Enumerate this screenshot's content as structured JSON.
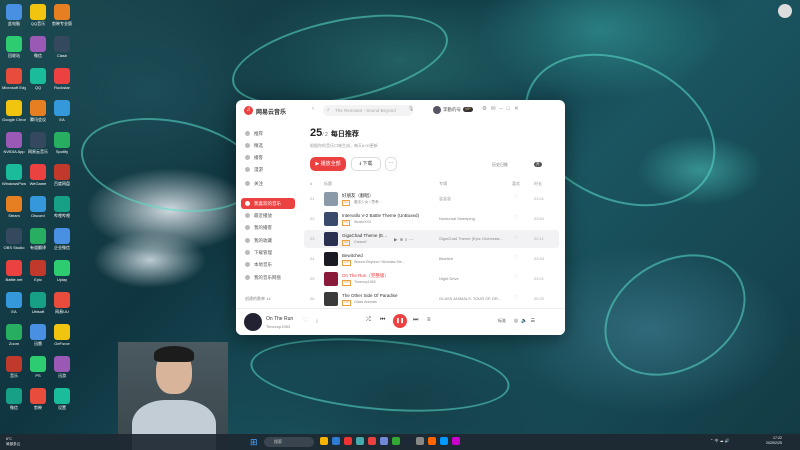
{
  "desktop": {
    "icons_left": [
      "此电脑",
      "回收站",
      "Microsoft Edge",
      "Google Chrome",
      "NVIDIA App",
      "WindowsPowerShell",
      "Steam",
      "OBS Studio",
      "Battle.net",
      "EA",
      "Zoom",
      "音乐",
      "微信"
    ],
    "icons_second": [
      "QQ音乐",
      "微信",
      "QQ",
      "腾讯会议",
      "网易云音乐",
      "WeGame",
      "Discord",
      "有道翻译",
      "Epic",
      "Ubisoft",
      "迅雷",
      "PS",
      "剪映"
    ],
    "icons_third": [
      "剪映专业版",
      "Clash",
      "Rockstar",
      "EA",
      "Spotify",
      "百度网盘",
      "哔哩哔哩",
      "企业微信",
      "Uplay",
      "网易UU",
      "GeForce",
      "迅游",
      "设置"
    ]
  },
  "window": {
    "app_name": "网易云音乐",
    "search_placeholder": "The Remnant - Sound Beyond",
    "username": "李勤的号",
    "vip_badge": "VIP",
    "sidebar": [
      {
        "label": "推荐",
        "active": false
      },
      {
        "label": "精选",
        "active": false
      },
      {
        "label": "播客",
        "active": false
      },
      {
        "label": "漫游",
        "active": false
      },
      {
        "label": "关注",
        "active": false
      },
      {
        "label": "我喜欢的音乐",
        "active": true
      },
      {
        "label": "最近播放",
        "active": false
      },
      {
        "label": "我的播客",
        "active": false
      },
      {
        "label": "我的收藏",
        "active": false
      },
      {
        "label": "下载管理",
        "active": false
      },
      {
        "label": "本地音乐",
        "active": false
      },
      {
        "label": "我的音乐网盘",
        "active": false
      }
    ],
    "sidebar_footer": "创建的歌单 14",
    "header": {
      "day": "25",
      "month": "/ 2",
      "title": "每日推荐",
      "subtitle": "根据你的音乐口味生成，每天6:00更新",
      "play_all": "▶ 播放全部",
      "download": "⭳ 下载",
      "more": "···",
      "history": "历史日推",
      "toggle": "开"
    },
    "columns": {
      "num": "#",
      "title": "标题",
      "album": "专辑",
      "like": "喜欢",
      "duration": "时长"
    },
    "tracks": [
      {
        "num": "01",
        "title": "好朋友（翻唱）",
        "tag": "SQ",
        "artist": "魔法少女 / 思考...",
        "album": "念念念",
        "duration": "03:41",
        "color": "#8a9aa8",
        "playing": false
      },
      {
        "num": "02",
        "title": "Intervallo V-2 Battle Theme (UnBoxed)",
        "tag": "SQ",
        "artist": "StudioXXX",
        "album": "Nocturnal Sweeping",
        "duration": "03:54",
        "color": "#3a4a6a",
        "playing": false
      },
      {
        "num": "03",
        "title": "GigaChad Theme (E...",
        "tag": "SQ",
        "artist": "Caravel",
        "album": "GigaChad Theme (Epic Orchestra...",
        "duration": "02:11",
        "color": "#2a3050",
        "playing": false
      },
      {
        "num": "04",
        "title": "Bewitched",
        "tag": "VIP",
        "artist": "Wound Beyond / Nicholas Ste...",
        "album": "Bewitch",
        "duration": "03:34",
        "color": "#1a1a22",
        "playing": false
      },
      {
        "num": "05",
        "title": "On The Run（完整版）",
        "tag": "VIP",
        "artist": "Timecop1983",
        "album": "Night Drive",
        "duration": "03:21",
        "color": "#8a1a3a",
        "playing": true
      },
      {
        "num": "06",
        "title": "The Other Side Of Paradise",
        "tag": "VIP",
        "artist": "Glass Animals",
        "album": "GLASS ANIMALS: TOUR OF DR...",
        "duration": "05:20",
        "color": "#3a3a3a",
        "playing": false
      }
    ],
    "player": {
      "title": "On The Run",
      "artist": "Timecop1983",
      "quality": "标准"
    }
  },
  "taskbar": {
    "weather_temp": "6°C",
    "weather_desc": "局部多云",
    "search_placeholder": "搜索",
    "time": "17:22",
    "date": "2025/2/25"
  }
}
